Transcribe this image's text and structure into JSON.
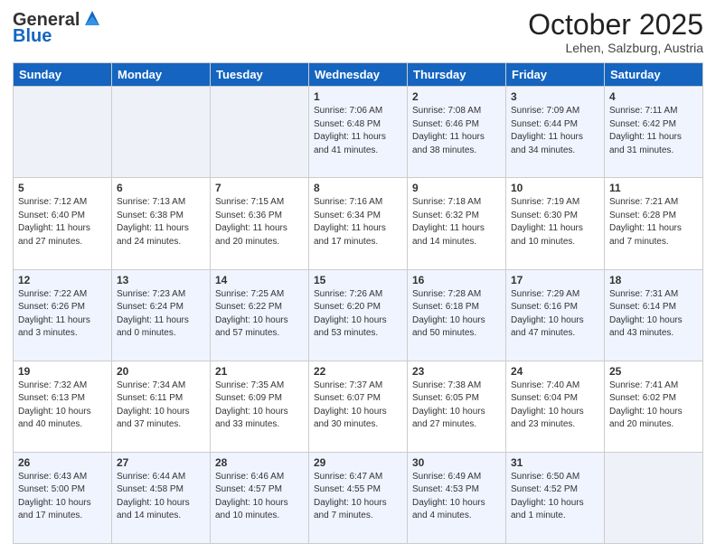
{
  "header": {
    "logo_general": "General",
    "logo_blue": "Blue",
    "month": "October 2025",
    "location": "Lehen, Salzburg, Austria"
  },
  "weekdays": [
    "Sunday",
    "Monday",
    "Tuesday",
    "Wednesday",
    "Thursday",
    "Friday",
    "Saturday"
  ],
  "weeks": [
    [
      {
        "day": "",
        "info": ""
      },
      {
        "day": "",
        "info": ""
      },
      {
        "day": "",
        "info": ""
      },
      {
        "day": "1",
        "info": "Sunrise: 7:06 AM\nSunset: 6:48 PM\nDaylight: 11 hours\nand 41 minutes."
      },
      {
        "day": "2",
        "info": "Sunrise: 7:08 AM\nSunset: 6:46 PM\nDaylight: 11 hours\nand 38 minutes."
      },
      {
        "day": "3",
        "info": "Sunrise: 7:09 AM\nSunset: 6:44 PM\nDaylight: 11 hours\nand 34 minutes."
      },
      {
        "day": "4",
        "info": "Sunrise: 7:11 AM\nSunset: 6:42 PM\nDaylight: 11 hours\nand 31 minutes."
      }
    ],
    [
      {
        "day": "5",
        "info": "Sunrise: 7:12 AM\nSunset: 6:40 PM\nDaylight: 11 hours\nand 27 minutes."
      },
      {
        "day": "6",
        "info": "Sunrise: 7:13 AM\nSunset: 6:38 PM\nDaylight: 11 hours\nand 24 minutes."
      },
      {
        "day": "7",
        "info": "Sunrise: 7:15 AM\nSunset: 6:36 PM\nDaylight: 11 hours\nand 20 minutes."
      },
      {
        "day": "8",
        "info": "Sunrise: 7:16 AM\nSunset: 6:34 PM\nDaylight: 11 hours\nand 17 minutes."
      },
      {
        "day": "9",
        "info": "Sunrise: 7:18 AM\nSunset: 6:32 PM\nDaylight: 11 hours\nand 14 minutes."
      },
      {
        "day": "10",
        "info": "Sunrise: 7:19 AM\nSunset: 6:30 PM\nDaylight: 11 hours\nand 10 minutes."
      },
      {
        "day": "11",
        "info": "Sunrise: 7:21 AM\nSunset: 6:28 PM\nDaylight: 11 hours\nand 7 minutes."
      }
    ],
    [
      {
        "day": "12",
        "info": "Sunrise: 7:22 AM\nSunset: 6:26 PM\nDaylight: 11 hours\nand 3 minutes."
      },
      {
        "day": "13",
        "info": "Sunrise: 7:23 AM\nSunset: 6:24 PM\nDaylight: 11 hours\nand 0 minutes."
      },
      {
        "day": "14",
        "info": "Sunrise: 7:25 AM\nSunset: 6:22 PM\nDaylight: 10 hours\nand 57 minutes."
      },
      {
        "day": "15",
        "info": "Sunrise: 7:26 AM\nSunset: 6:20 PM\nDaylight: 10 hours\nand 53 minutes."
      },
      {
        "day": "16",
        "info": "Sunrise: 7:28 AM\nSunset: 6:18 PM\nDaylight: 10 hours\nand 50 minutes."
      },
      {
        "day": "17",
        "info": "Sunrise: 7:29 AM\nSunset: 6:16 PM\nDaylight: 10 hours\nand 47 minutes."
      },
      {
        "day": "18",
        "info": "Sunrise: 7:31 AM\nSunset: 6:14 PM\nDaylight: 10 hours\nand 43 minutes."
      }
    ],
    [
      {
        "day": "19",
        "info": "Sunrise: 7:32 AM\nSunset: 6:13 PM\nDaylight: 10 hours\nand 40 minutes."
      },
      {
        "day": "20",
        "info": "Sunrise: 7:34 AM\nSunset: 6:11 PM\nDaylight: 10 hours\nand 37 minutes."
      },
      {
        "day": "21",
        "info": "Sunrise: 7:35 AM\nSunset: 6:09 PM\nDaylight: 10 hours\nand 33 minutes."
      },
      {
        "day": "22",
        "info": "Sunrise: 7:37 AM\nSunset: 6:07 PM\nDaylight: 10 hours\nand 30 minutes."
      },
      {
        "day": "23",
        "info": "Sunrise: 7:38 AM\nSunset: 6:05 PM\nDaylight: 10 hours\nand 27 minutes."
      },
      {
        "day": "24",
        "info": "Sunrise: 7:40 AM\nSunset: 6:04 PM\nDaylight: 10 hours\nand 23 minutes."
      },
      {
        "day": "25",
        "info": "Sunrise: 7:41 AM\nSunset: 6:02 PM\nDaylight: 10 hours\nand 20 minutes."
      }
    ],
    [
      {
        "day": "26",
        "info": "Sunrise: 6:43 AM\nSunset: 5:00 PM\nDaylight: 10 hours\nand 17 minutes."
      },
      {
        "day": "27",
        "info": "Sunrise: 6:44 AM\nSunset: 4:58 PM\nDaylight: 10 hours\nand 14 minutes."
      },
      {
        "day": "28",
        "info": "Sunrise: 6:46 AM\nSunset: 4:57 PM\nDaylight: 10 hours\nand 10 minutes."
      },
      {
        "day": "29",
        "info": "Sunrise: 6:47 AM\nSunset: 4:55 PM\nDaylight: 10 hours\nand 7 minutes."
      },
      {
        "day": "30",
        "info": "Sunrise: 6:49 AM\nSunset: 4:53 PM\nDaylight: 10 hours\nand 4 minutes."
      },
      {
        "day": "31",
        "info": "Sunrise: 6:50 AM\nSunset: 4:52 PM\nDaylight: 10 hours\nand 1 minute."
      },
      {
        "day": "",
        "info": ""
      }
    ]
  ]
}
